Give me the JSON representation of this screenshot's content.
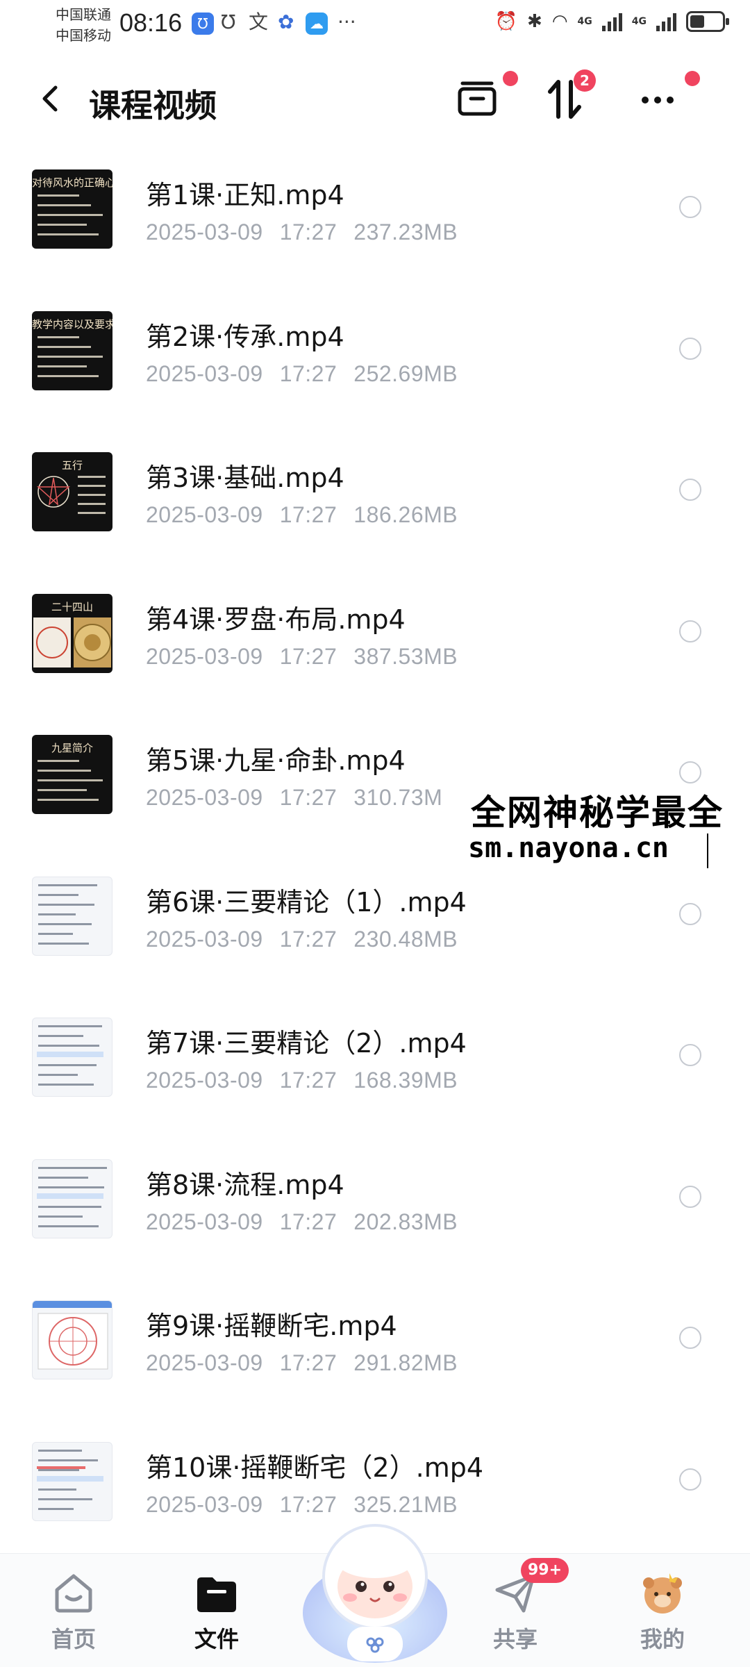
{
  "status_bar": {
    "carrier_1": "中国联通",
    "carrier_2": "中国移动",
    "time": "08:16",
    "app_icons": [
      "alarm-app-icon",
      "u-app-icon",
      "translate-app-icon",
      "baidu-app-icon",
      "weather-app-icon"
    ],
    "more_indicator": "···",
    "network_1": "4G",
    "network_2": "4G",
    "battery_level": 0.45
  },
  "header": {
    "title": "课程视频",
    "sort_badge": "2"
  },
  "files": [
    {
      "name": "第1课·正知.mp4",
      "date": "2025-03-09",
      "time": "17:27",
      "size": "237.23MB",
      "thumb": "dark",
      "thumb_title": "对待风水的正确心态"
    },
    {
      "name": "第2课·传承.mp4",
      "date": "2025-03-09",
      "time": "17:27",
      "size": "252.69MB",
      "thumb": "dark",
      "thumb_title": "教学内容以及要求"
    },
    {
      "name": "第3课·基础.mp4",
      "date": "2025-03-09",
      "time": "17:27",
      "size": "186.26MB",
      "thumb": "dark",
      "thumb_title": "五行"
    },
    {
      "name": "第4课·罗盘·布局.mp4",
      "date": "2025-03-09",
      "time": "17:27",
      "size": "387.53MB",
      "thumb": "dark",
      "thumb_title": "二十四山"
    },
    {
      "name": "第5课·九星·命卦.mp4",
      "date": "2025-03-09",
      "time": "17:27",
      "size": "310.73M",
      "thumb": "dark",
      "thumb_title": "九星简介"
    },
    {
      "name": "第6课·三要精论（1）.mp4",
      "date": "2025-03-09",
      "time": "17:27",
      "size": "230.48MB",
      "thumb": "light",
      "thumb_title": ""
    },
    {
      "name": "第7课·三要精论（2）.mp4",
      "date": "2025-03-09",
      "time": "17:27",
      "size": "168.39MB",
      "thumb": "light",
      "thumb_title": ""
    },
    {
      "name": "第8课·流程.mp4",
      "date": "2025-03-09",
      "time": "17:27",
      "size": "202.83MB",
      "thumb": "light",
      "thumb_title": ""
    },
    {
      "name": "第9课·摇鞭断宅.mp4",
      "date": "2025-03-09",
      "time": "17:27",
      "size": "291.82MB",
      "thumb": "light",
      "thumb_title": ""
    },
    {
      "name": "第10课·摇鞭断宅（2）.mp4",
      "date": "2025-03-09",
      "time": "17:27",
      "size": "325.21MB",
      "thumb": "light",
      "thumb_title": ""
    }
  ],
  "watermark": {
    "line1": "全网神秘学最全",
    "line2": "sm.nayona.cn"
  },
  "bottom_nav": {
    "home": "首页",
    "files": "文件",
    "share": "共享",
    "mine": "我的",
    "share_badge": "99+"
  },
  "colors": {
    "accent_red": "#f0445f",
    "meta_gray": "#a3a8b0",
    "nav_inactive": "#8a8f99"
  }
}
